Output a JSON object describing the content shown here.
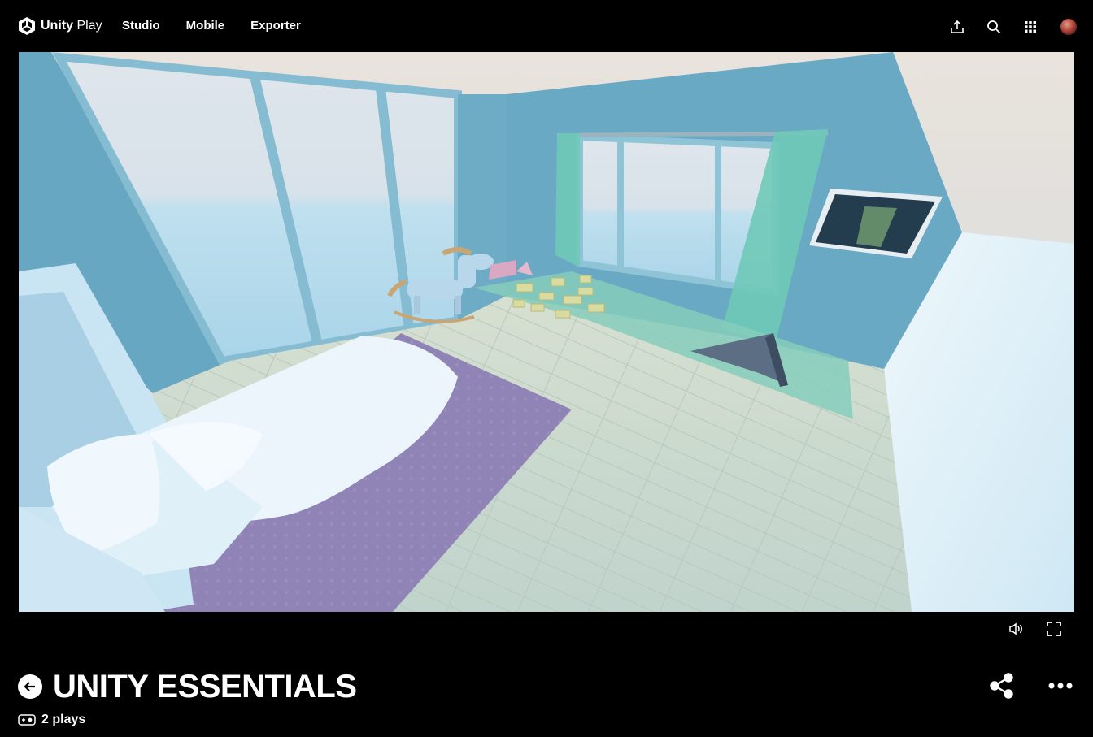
{
  "header": {
    "logo_brand": "Unity",
    "logo_product": "Play",
    "nav": [
      {
        "label": "Studio"
      },
      {
        "label": "Mobile"
      },
      {
        "label": "Exporter"
      }
    ],
    "actions": [
      "upload-icon",
      "search-icon",
      "apps-grid-icon",
      "user-avatar"
    ]
  },
  "player": {
    "scene_description_icon": "game-canvas",
    "controls": [
      "volume-icon",
      "fullscreen-icon"
    ]
  },
  "game": {
    "title": "UNITY ESSENTIALS",
    "plays": "2 plays"
  },
  "title_actions": [
    "share-icon",
    "more-options-icon"
  ],
  "colors": {
    "background": "#000000",
    "text": "#ffffff",
    "wall": "#6aa9c4",
    "floor": "#c8d8cf",
    "rug": "#8f84b5"
  }
}
